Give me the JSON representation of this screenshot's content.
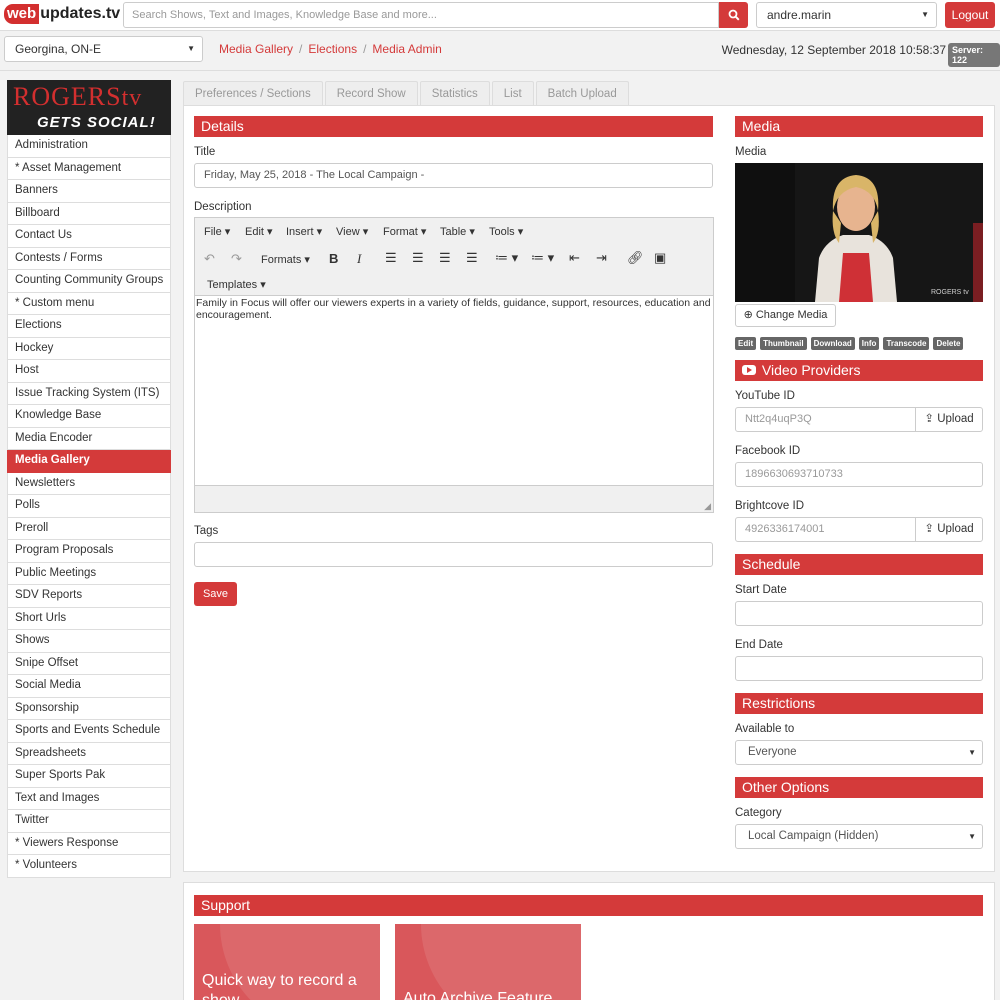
{
  "topbar": {
    "logo_web": "web",
    "logo_rest": "updates.tv",
    "search_placeholder": "Search Shows, Text and Images, Knowledge Base and more...",
    "user": "andre.marin",
    "logout_label": "Logout"
  },
  "secondbar": {
    "location": "Georgina, ON-E",
    "breadcrumb": [
      "Media Gallery",
      "Elections",
      "Media Admin"
    ],
    "datetime": "Wednesday, 12 September 2018 10:58:37",
    "server": "Server: 122"
  },
  "brand": {
    "top": "ROGERS",
    "top_suffix": "tv",
    "bottom": "GETS SOCIAL!"
  },
  "sidebar": {
    "items": [
      {
        "label": "Administration",
        "active": false
      },
      {
        "label": "* Asset Management",
        "active": false
      },
      {
        "label": "Banners",
        "active": false
      },
      {
        "label": "Billboard",
        "active": false
      },
      {
        "label": "Contact Us",
        "active": false
      },
      {
        "label": "Contests / Forms",
        "active": false
      },
      {
        "label": "Counting Community Groups",
        "active": false
      },
      {
        "label": "* Custom menu",
        "active": false
      },
      {
        "label": "Elections",
        "active": false
      },
      {
        "label": "Hockey",
        "active": false
      },
      {
        "label": "Host",
        "active": false
      },
      {
        "label": "Issue Tracking System (ITS)",
        "active": false
      },
      {
        "label": "Knowledge Base",
        "active": false
      },
      {
        "label": "Media Encoder",
        "active": false
      },
      {
        "label": "Media Gallery",
        "active": true
      },
      {
        "label": "Newsletters",
        "active": false
      },
      {
        "label": "Polls",
        "active": false
      },
      {
        "label": "Preroll",
        "active": false
      },
      {
        "label": "Program Proposals",
        "active": false
      },
      {
        "label": "Public Meetings",
        "active": false
      },
      {
        "label": "SDV Reports",
        "active": false
      },
      {
        "label": "Short Urls",
        "active": false
      },
      {
        "label": "Shows",
        "active": false
      },
      {
        "label": "Snipe Offset",
        "active": false
      },
      {
        "label": "Social Media",
        "active": false
      },
      {
        "label": "Sponsorship",
        "active": false
      },
      {
        "label": "Sports and Events Schedule",
        "active": false
      },
      {
        "label": "Spreadsheets",
        "active": false
      },
      {
        "label": "Super Sports Pak",
        "active": false
      },
      {
        "label": "Text and Images",
        "active": false
      },
      {
        "label": "Twitter",
        "active": false
      },
      {
        "label": "* Viewers Response",
        "active": false
      },
      {
        "label": "* Volunteers",
        "active": false
      }
    ]
  },
  "tabs": [
    "Preferences / Sections",
    "Record Show",
    "Statistics",
    "List",
    "Batch Upload"
  ],
  "details": {
    "header": "Details",
    "title_label": "Title",
    "title_value": "Friday, May 25, 2018 - The Local Campaign -",
    "description_label": "Description",
    "editor_menus": [
      "File",
      "Edit",
      "Insert",
      "View",
      "Format",
      "Table",
      "Tools"
    ],
    "formats_label": "Formats",
    "templates_label": "Templates",
    "description_text": "Family in Focus will offer our viewers experts in a variety of fields, guidance, support, resources, education and encouragement.",
    "tags_label": "Tags",
    "tags_value": "",
    "save_label": "Save"
  },
  "media": {
    "header": "Media",
    "media_label": "Media",
    "thumb_watermark": "ROGERS tv",
    "change_media_label": "Change Media",
    "mini_buttons": [
      "Edit",
      "Thumbnail",
      "Download",
      "Info",
      "Transcode",
      "Delete"
    ]
  },
  "video_providers": {
    "header": "Video Providers",
    "youtube_label": "YouTube ID",
    "youtube_value": "Ntt2q4uqP3Q",
    "facebook_label": "Facebook ID",
    "facebook_value": "1896630693710733",
    "brightcove_label": "Brightcove ID",
    "brightcove_value": "4926336174001",
    "upload_label": "Upload"
  },
  "schedule": {
    "header": "Schedule",
    "start_label": "Start Date",
    "start_value": "",
    "end_label": "End Date",
    "end_value": ""
  },
  "restrictions": {
    "header": "Restrictions",
    "available_label": "Available to",
    "available_value": "Everyone"
  },
  "other": {
    "header": "Other Options",
    "category_label": "Category",
    "category_value": "Local Campaign (Hidden)"
  },
  "support": {
    "header": "Support",
    "cards": [
      "Quick way to record a show",
      "Auto Archive Feature"
    ]
  },
  "colors": {
    "accent": "#d43a3a",
    "active_menu": "#d43a3a",
    "card": "#d9575b"
  }
}
